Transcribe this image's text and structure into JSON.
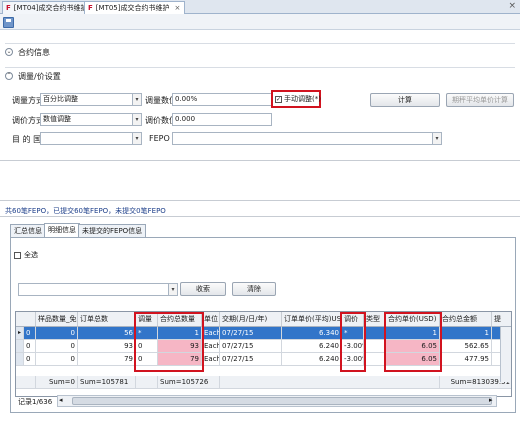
{
  "tabs": [
    {
      "label": "[MT04]成交合约书维护",
      "active": false
    },
    {
      "label": "[MT05]成交合约书维护",
      "active": true
    }
  ],
  "sections": {
    "contract_info": "合约信息",
    "adjust_settings": "调量/价设置"
  },
  "form": {
    "adjust_method_label": "调量方式",
    "adjust_method_value": "百分比调整",
    "adjust_value_label": "调量数值",
    "adjust_value_value": "0.00%",
    "manual_adjust_label": "手动调整(*)",
    "manual_adjust_checked": true,
    "calc_button": "计算",
    "recalc_button": "期秤平均单价计算",
    "price_method_label": "调价方式",
    "price_method_value": "数值调整",
    "price_value_label": "调价数值",
    "price_value_value": "0.000",
    "destination_label": "目 的 国:",
    "destination_value": "",
    "fepo_label": "FEPO :",
    "fepo_value": ""
  },
  "infobar": "共60笔FEPO，已提交60笔FEPO，未提交0笔FEPO",
  "detail_tabs": [
    {
      "label": "汇总信息",
      "active": false
    },
    {
      "label": "明细信息",
      "active": true
    },
    {
      "label": "未提交的FEPO信息",
      "active": false
    }
  ],
  "select_all_label": "全选",
  "filter": {
    "value": "",
    "query_button": "收索",
    "clear_button": "清除"
  },
  "grid": {
    "headers": [
      "",
      "样品数量_免费",
      "订单总数",
      "调量",
      "合约总数量",
      "单位",
      "交期(月/日/年)",
      "订单单价(平均)USD",
      "调价",
      "类型",
      "合约单价(USD)",
      "合约总金额",
      "提"
    ],
    "rows": [
      {
        "sel": "0",
        "sample": "0",
        "order": "56",
        "adj": "*",
        "qty": "1",
        "unit": "Each",
        "date": "07/27/15",
        "price": "6.340",
        "padj": "*",
        "type": "",
        "cprice": "1",
        "amount": "1",
        "selected": true
      },
      {
        "sel": "0",
        "sample": "0",
        "order": "93",
        "adj": "0",
        "qty": "93",
        "unit": "Each",
        "date": "07/27/15",
        "price": "6.240",
        "padj": "-3.00%",
        "type": "",
        "cprice": "6.05",
        "amount": "562.65",
        "selected": false
      },
      {
        "sel": "0",
        "sample": "0",
        "order": "79",
        "adj": "0",
        "qty": "79",
        "unit": "Each",
        "date": "07/27/15",
        "price": "6.240",
        "padj": "-3.00%",
        "type": "",
        "cprice": "6.05",
        "amount": "477.95",
        "selected": false
      }
    ],
    "sums": {
      "sample": "Sum=0",
      "order": "Sum=105781",
      "qty": "Sum=105726",
      "amount": "Sum=813039.51"
    }
  },
  "record_label": "记录1/636",
  "colors": {
    "highlight_red": "#d1131f",
    "selected_row": "#3275c9",
    "pink_cell": "#f6b6c5"
  }
}
